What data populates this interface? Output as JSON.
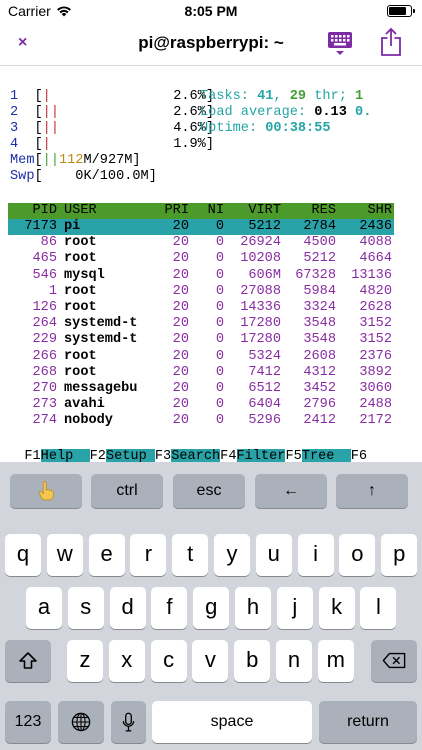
{
  "status_bar": {
    "carrier": "Carrier",
    "time": "8:05 PM"
  },
  "nav": {
    "title": "pi@raspberrypi: ~",
    "close_glyph": "×"
  },
  "colors": {
    "accent": "#7d2aa5",
    "header_green": "#4c9a2a",
    "highlight_cyan": "#2aa3a8"
  },
  "htop": {
    "cpus": [
      {
        "num": "1",
        "bar": "|",
        "pct": "2.6%"
      },
      {
        "num": "2",
        "bar": "||",
        "pct": "2.6%"
      },
      {
        "num": "3",
        "bar": "||",
        "pct": "4.6%"
      },
      {
        "num": "4",
        "bar": "|",
        "pct": "1.9%"
      }
    ],
    "mem": {
      "label": "Mem",
      "bar": "||",
      "used": "112",
      "total": "M/927M"
    },
    "swp": {
      "label": "Swp",
      "value": "0K/100.0M"
    },
    "tasks": {
      "label": "Tasks: ",
      "count": "41",
      "thr_count": "29",
      "thr_label": " thr; ",
      "running": "1"
    },
    "load": {
      "label": "Load average: ",
      "v1": "0.13",
      "v2": "0."
    },
    "uptime": {
      "label": "Uptime: ",
      "value": "00:38:55"
    },
    "columns": [
      "PID",
      "USER",
      "PRI",
      "NI",
      "VIRT",
      "RES",
      "SHR"
    ],
    "processes": [
      {
        "pid": "7173",
        "user": "pi",
        "pri": "20",
        "ni": "0",
        "virt": "5212",
        "res": "2784",
        "shr": "2436",
        "selected": true
      },
      {
        "pid": "86",
        "user": "root",
        "pri": "20",
        "ni": "0",
        "virt": "26924",
        "res": "4500",
        "shr": "4088"
      },
      {
        "pid": "465",
        "user": "root",
        "pri": "20",
        "ni": "0",
        "virt": "10208",
        "res": "5212",
        "shr": "4664"
      },
      {
        "pid": "546",
        "user": "mysql",
        "pri": "20",
        "ni": "0",
        "virt": "606M",
        "res": "67328",
        "shr": "13136"
      },
      {
        "pid": "1",
        "user": "root",
        "pri": "20",
        "ni": "0",
        "virt": "27088",
        "res": "5984",
        "shr": "4820"
      },
      {
        "pid": "126",
        "user": "root",
        "pri": "20",
        "ni": "0",
        "virt": "14336",
        "res": "3324",
        "shr": "2628"
      },
      {
        "pid": "264",
        "user": "systemd-t",
        "pri": "20",
        "ni": "0",
        "virt": "17280",
        "res": "3548",
        "shr": "3152"
      },
      {
        "pid": "229",
        "user": "systemd-t",
        "pri": "20",
        "ni": "0",
        "virt": "17280",
        "res": "3548",
        "shr": "3152"
      },
      {
        "pid": "266",
        "user": "root",
        "pri": "20",
        "ni": "0",
        "virt": "5324",
        "res": "2608",
        "shr": "2376"
      },
      {
        "pid": "268",
        "user": "root",
        "pri": "20",
        "ni": "0",
        "virt": "7412",
        "res": "4312",
        "shr": "3892"
      },
      {
        "pid": "270",
        "user": "messagebu",
        "pri": "20",
        "ni": "0",
        "virt": "6512",
        "res": "3452",
        "shr": "3060"
      },
      {
        "pid": "273",
        "user": "avahi",
        "pri": "20",
        "ni": "0",
        "virt": "6404",
        "res": "2796",
        "shr": "2488"
      },
      {
        "pid": "274",
        "user": "nobody",
        "pri": "20",
        "ni": "0",
        "virt": "5296",
        "res": "2412",
        "shr": "2172"
      }
    ],
    "fkeys": [
      {
        "num": "F1",
        "label": "Help  "
      },
      {
        "num": "F2",
        "label": "Setup "
      },
      {
        "num": "F3",
        "label": "Search"
      },
      {
        "num": "F4",
        "label": "Filter"
      },
      {
        "num": "F5",
        "label": "Tree  "
      },
      {
        "num": "F6",
        "label": ""
      }
    ]
  },
  "keyboard": {
    "accessory": {
      "touch_icon": "pointing-hand-icon",
      "ctrl": "ctrl",
      "esc": "esc",
      "left": "←",
      "up": "↑"
    },
    "row1": [
      "q",
      "w",
      "e",
      "r",
      "t",
      "y",
      "u",
      "i",
      "o",
      "p"
    ],
    "row2": [
      "a",
      "s",
      "d",
      "f",
      "g",
      "h",
      "j",
      "k",
      "l"
    ],
    "row3": [
      "z",
      "x",
      "c",
      "v",
      "b",
      "n",
      "m"
    ],
    "numbers": "123",
    "space": "space",
    "return": "return"
  }
}
